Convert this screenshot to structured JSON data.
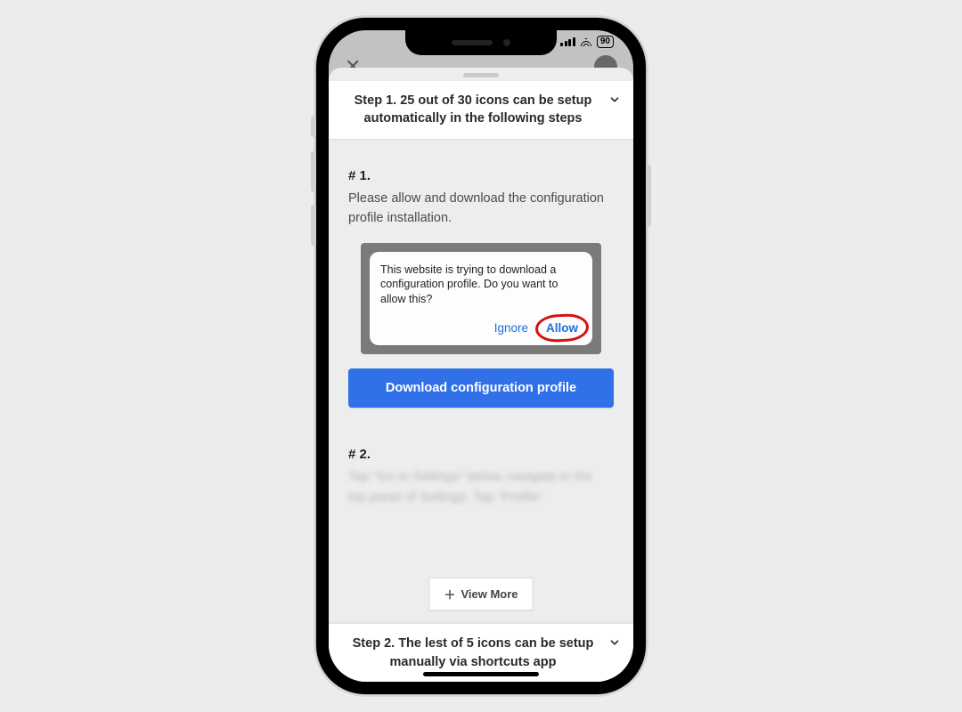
{
  "status": {
    "battery": "90"
  },
  "dimmed": {
    "close": "✕",
    "title": "",
    "avatar": ""
  },
  "sheet": {
    "step1": {
      "title": "Step 1. 25 out of 30 icons can be setup automatically in the following steps"
    },
    "section1": {
      "num": "# 1.",
      "text": "Please allow and download the configuration profile installation."
    },
    "shot": {
      "body": "This website is trying to download a configuration profile. Do you want to allow this?",
      "ignore": "Ignore",
      "allow": "Allow"
    },
    "cta": "Download configuration profile",
    "section2": {
      "num": "# 2.",
      "text": "Tap \"Go to Settings\" below, navigate to the top panel of Settings. Tap \"Profile\""
    },
    "view_more": "View More",
    "step2": {
      "title": "Step 2. The lest of 5 icons can be setup manually via shortcuts app"
    }
  }
}
